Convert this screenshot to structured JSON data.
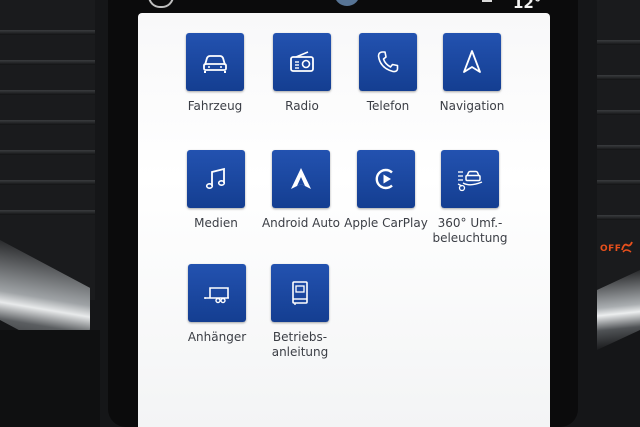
{
  "status_bar": {
    "temperature": "12°"
  },
  "apps": [
    {
      "label": "Fahrzeug",
      "icon": "car-icon"
    },
    {
      "label": "Radio",
      "icon": "radio-icon"
    },
    {
      "label": "Telefon",
      "icon": "phone-icon"
    },
    {
      "label": "Navigation",
      "icon": "navigation-arrow-icon"
    },
    {
      "label": "Medien",
      "icon": "music-note-icon"
    },
    {
      "label": "Android Auto",
      "icon": "android-auto-icon"
    },
    {
      "label": "Apple CarPlay",
      "icon": "carplay-icon"
    },
    {
      "label": "360° Umf.-\nbeleuchtung",
      "icon": "ambient-light-icon"
    },
    {
      "label": "Anhänger",
      "icon": "trailer-icon"
    },
    {
      "label": "Betriebs-\nanleitung",
      "icon": "manual-book-icon"
    }
  ],
  "dashboard": {
    "off_indicator": "OFF"
  },
  "colors": {
    "tile": "#1a47a1",
    "screen": "#ffffff",
    "indicator": "#e8501c"
  }
}
